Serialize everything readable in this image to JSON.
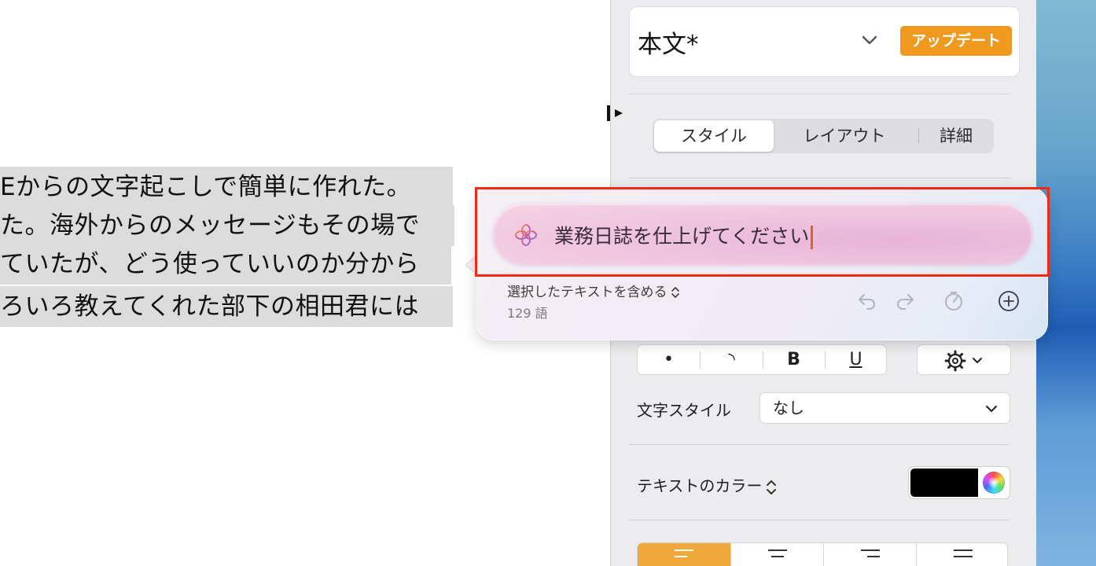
{
  "document": {
    "lines": [
      "Eからの文字起こしで簡単に作れた。",
      "た。海外からのメッセージもその場で",
      "ていたが、どう使っていいのか分から",
      "ろいろ教えてくれた部下の相田君には"
    ]
  },
  "sidebar": {
    "paragraph_style": "本文*",
    "update_button": "アップデート",
    "tabs": [
      "スタイル",
      "レイアウト",
      "詳細"
    ],
    "active_tab": "スタイル",
    "format_buttons": [
      "•",
      "◝",
      "B",
      "U"
    ],
    "char_style_label": "文字スタイル",
    "char_style_value": "なし",
    "text_color_label": "テキストのカラー",
    "text_color_value": "#000000"
  },
  "writing_tools": {
    "prompt_text": "業務日誌を仕上げてください",
    "include_selection_label": "選択したテキストを含める",
    "word_count": "129 語",
    "icons": [
      "undo-icon",
      "redo-icon",
      "speed-icon",
      "add-icon"
    ]
  },
  "colors": {
    "accent_orange": "#f0991f",
    "highlight_red": "#ee2a16",
    "selection_gray": "#dcdcdc"
  }
}
